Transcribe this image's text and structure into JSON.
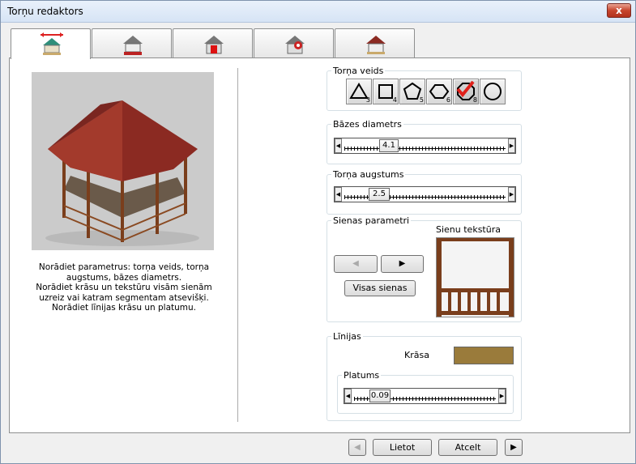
{
  "window": {
    "title": "Torņu redaktors",
    "close_label": "x"
  },
  "tabs": [
    {
      "icon": "gazebo-dimensions-icon",
      "active": true
    },
    {
      "icon": "gazebo-roof-icon",
      "active": false
    },
    {
      "icon": "gazebo-door-icon",
      "active": false
    },
    {
      "icon": "gazebo-settings-icon",
      "active": false
    },
    {
      "icon": "gazebo-color-icon",
      "active": false
    }
  ],
  "description": {
    "line1": "Norādiet parametrus: torņa veids, torņa augstums, bāzes diametrs.",
    "line2": "Norādiet krāsu un tekstūru visām sienām uzreiz vai katram segmentam atsevišķi. Norādiet līnijas krāsu un platumu."
  },
  "tower_type": {
    "label": "Torņa veids",
    "shapes": [
      {
        "icon": "triangle-icon",
        "num": "3"
      },
      {
        "icon": "square-icon",
        "num": "4"
      },
      {
        "icon": "pentagon-icon",
        "num": "5"
      },
      {
        "icon": "hexagon-icon",
        "num": "6"
      },
      {
        "icon": "octagon-icon",
        "num": "8",
        "selected": true
      },
      {
        "icon": "circle-icon",
        "num": ""
      }
    ]
  },
  "base_diameter": {
    "label": "Bāzes diametrs",
    "value": "4.1",
    "fraction": 0.25
  },
  "tower_height": {
    "label": "Torņa augstums",
    "value": "2.5",
    "fraction": 0.2
  },
  "walls": {
    "label": "Sienas parametri",
    "texture_label": "Sienu tekstūra",
    "all_walls_label": "Visas sienas"
  },
  "lines": {
    "label": "Līnijas",
    "color_label": "Krāsa",
    "color": "#9a7b3b",
    "width_label": "Platums",
    "width_value": "0.09",
    "width_fraction": 0.12
  },
  "footer": {
    "apply_label": "Lietot",
    "cancel_label": "Atcelt"
  },
  "colors": {
    "roof": "#8b2a22",
    "wood": "#7a3e1c",
    "check": "#e0201a"
  }
}
